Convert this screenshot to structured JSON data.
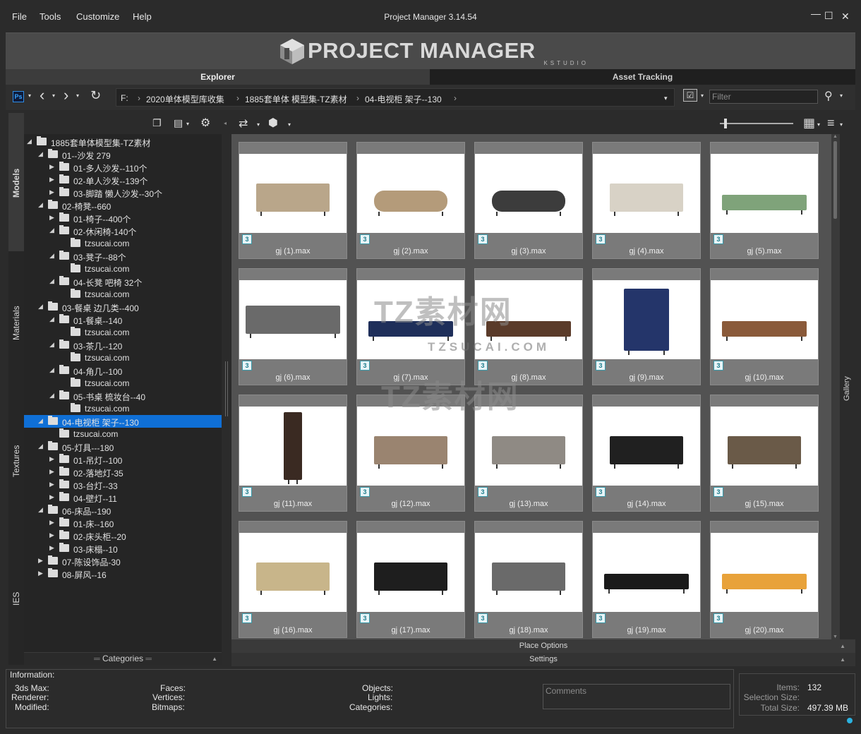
{
  "menu": [
    "File",
    "Tools",
    "Customize",
    "Help"
  ],
  "app_title": "Project Manager 3.14.54",
  "window_buttons": {
    "minimize": "—",
    "maximize": "☐",
    "close": "✕"
  },
  "banner": {
    "logo_text": "PROJECT MANAGER",
    "logo_sub": "KSTUDIO"
  },
  "tabs": {
    "explorer": "Explorer",
    "asset_tracking": "Asset Tracking"
  },
  "toolbar": {
    "ps_label": "Ps",
    "breadcrumb": [
      "F:",
      "2020单体模型库收集",
      "1885套单体 模型集-TZ素材",
      "04-电视柜 架子--130"
    ],
    "filter_placeholder": "Filter"
  },
  "side_tabs": [
    "Models",
    "Materials",
    "Textures",
    "IES"
  ],
  "tree": [
    {
      "label": "1885套单体模型集-TZ素材",
      "level": 0,
      "state": "open"
    },
    {
      "label": "01--沙发 279",
      "level": 1,
      "state": "open"
    },
    {
      "label": "01-多人沙发--110个",
      "level": 2,
      "state": "closed"
    },
    {
      "label": "02-单人沙发--139个",
      "level": 2,
      "state": "closed"
    },
    {
      "label": "03-脚踏 懒人沙发--30个",
      "level": 2,
      "state": "closed"
    },
    {
      "label": "02-椅凳--660",
      "level": 1,
      "state": "open"
    },
    {
      "label": "01-椅子--400个",
      "level": 2,
      "state": "closed"
    },
    {
      "label": "02-休闲椅-140个",
      "level": 2,
      "state": "open"
    },
    {
      "label": "tzsucai.com",
      "level": 3,
      "state": "none"
    },
    {
      "label": "03-凳子--88个",
      "level": 2,
      "state": "open"
    },
    {
      "label": "tzsucai.com",
      "level": 3,
      "state": "none"
    },
    {
      "label": "04-长凳 吧椅 32个",
      "level": 2,
      "state": "open"
    },
    {
      "label": "tzsucai.com",
      "level": 3,
      "state": "none"
    },
    {
      "label": "03-餐桌 边几类--400",
      "level": 1,
      "state": "open"
    },
    {
      "label": "01-餐桌--140",
      "level": 2,
      "state": "open"
    },
    {
      "label": "tzsucai.com",
      "level": 3,
      "state": "none"
    },
    {
      "label": "03-茶几--120",
      "level": 2,
      "state": "open"
    },
    {
      "label": "tzsucai.com",
      "level": 3,
      "state": "none"
    },
    {
      "label": "04-角几--100",
      "level": 2,
      "state": "open"
    },
    {
      "label": "tzsucai.com",
      "level": 3,
      "state": "none"
    },
    {
      "label": "05-书桌 梳妆台--40",
      "level": 2,
      "state": "open"
    },
    {
      "label": "tzsucai.com",
      "level": 3,
      "state": "none"
    },
    {
      "label": "04-电视柜 架子--130",
      "level": 1,
      "state": "open",
      "selected": true
    },
    {
      "label": "tzsucai.com",
      "level": 2,
      "state": "none"
    },
    {
      "label": "05-灯具---180",
      "level": 1,
      "state": "open"
    },
    {
      "label": "01-吊灯--100",
      "level": 2,
      "state": "closed"
    },
    {
      "label": "02-落地灯-35",
      "level": 2,
      "state": "closed"
    },
    {
      "label": "03-台灯--33",
      "level": 2,
      "state": "closed"
    },
    {
      "label": "04-壁灯--11",
      "level": 2,
      "state": "closed"
    },
    {
      "label": "06-床品--190",
      "level": 1,
      "state": "open"
    },
    {
      "label": "01-床--160",
      "level": 2,
      "state": "closed"
    },
    {
      "label": "02-床头柜--20",
      "level": 2,
      "state": "closed"
    },
    {
      "label": "03-床榻--10",
      "level": 2,
      "state": "closed"
    },
    {
      "label": "07-陈设饰品-30",
      "level": 1,
      "state": "closed"
    },
    {
      "label": "08-屏风--16",
      "level": 1,
      "state": "closed"
    }
  ],
  "categories_label": "Categories",
  "gallery": {
    "side_label": "Gallery",
    "badge": "3",
    "items": [
      {
        "file": "gj (1).max",
        "color": "#b9a68a",
        "shape": "sideboard"
      },
      {
        "file": "gj (2).max",
        "color": "#b49b7a",
        "shape": "oval"
      },
      {
        "file": "gj (3).max",
        "color": "#3c3c3c",
        "shape": "oval"
      },
      {
        "file": "gj (4).max",
        "color": "#d8d2c6",
        "shape": "sideboard"
      },
      {
        "file": "gj (5).max",
        "color": "#7fa37a",
        "shape": "low"
      },
      {
        "file": "gj (6).max",
        "color": "#6a6a6a",
        "shape": "tall"
      },
      {
        "file": "gj (7).max",
        "color": "#1f2f5a",
        "shape": "low"
      },
      {
        "file": "gj (8).max",
        "color": "#5a3b2a",
        "shape": "low"
      },
      {
        "file": "gj (9).max",
        "color": "#24356a",
        "shape": "cabinet"
      },
      {
        "file": "gj (10).max",
        "color": "#8a5a3a",
        "shape": "low"
      },
      {
        "file": "gj (11).max",
        "color": "#3a2a22",
        "shape": "tower"
      },
      {
        "file": "gj (12).max",
        "color": "#9a8470",
        "shape": "sideboard"
      },
      {
        "file": "gj (13).max",
        "color": "#8f8a84",
        "shape": "sideboard"
      },
      {
        "file": "gj (14).max",
        "color": "#202020",
        "shape": "sideboard"
      },
      {
        "file": "gj (15).max",
        "color": "#6a5a48",
        "shape": "sideboard"
      },
      {
        "file": "gj (16).max",
        "color": "#c8b58a",
        "shape": "sideboard"
      },
      {
        "file": "gj (17).max",
        "color": "#1e1e1e",
        "shape": "sideboard"
      },
      {
        "file": "gj (18).max",
        "color": "#6a6a6a",
        "shape": "sideboard"
      },
      {
        "file": "gj (19).max",
        "color": "#1a1a1a",
        "shape": "low"
      },
      {
        "file": "gj (20).max",
        "color": "#e8a23a",
        "shape": "low"
      }
    ]
  },
  "watermark": {
    "brand": "TZ素材网",
    "domain": "TZSUCAI.COM"
  },
  "bottom": {
    "place_options": "Place Options",
    "settings": "Settings"
  },
  "info": {
    "title": "Information:",
    "col1": [
      "3ds Max:",
      "Renderer:",
      "Modified:"
    ],
    "col2": [
      "Faces:",
      "Vertices:",
      "Bitmaps:"
    ],
    "col3": [
      "Objects:",
      "Lights:",
      "Categories:"
    ],
    "comments_placeholder": "Comments"
  },
  "stats": {
    "items_label": "Items:",
    "items_value": "132",
    "selection_label": "Selection Size:",
    "selection_value": "",
    "total_label": "Total Size:",
    "total_value": "497.39 MB"
  }
}
